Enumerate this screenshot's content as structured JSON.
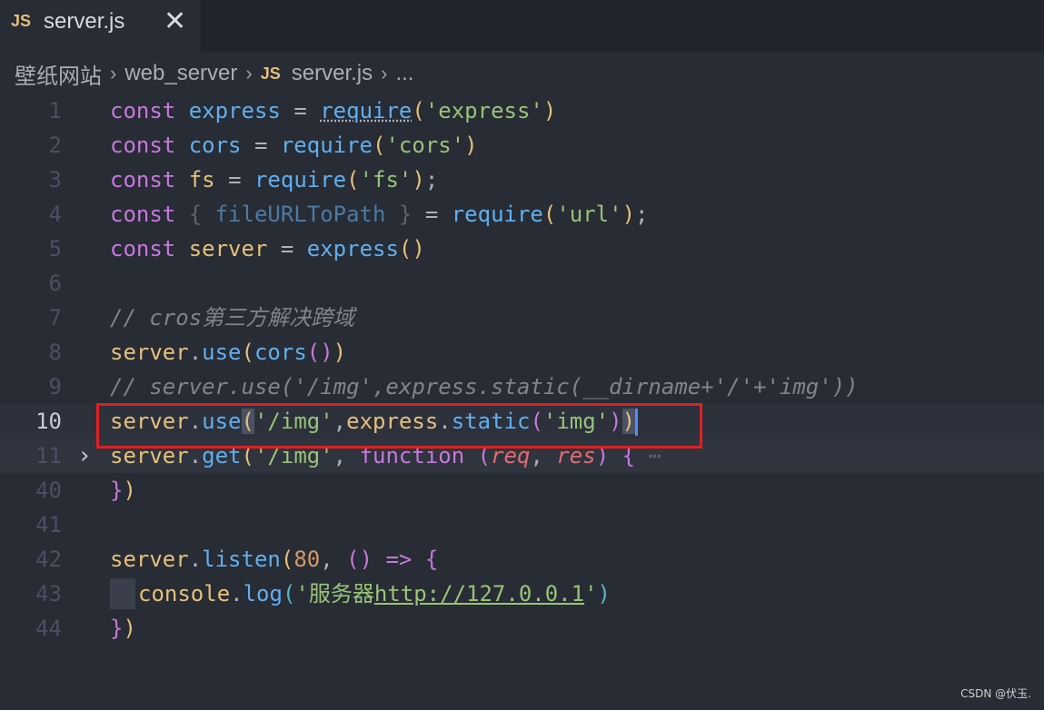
{
  "tab": {
    "icon": "JS",
    "title": "server.js",
    "close": "✕"
  },
  "breadcrumb": {
    "folder1": "壁纸网站",
    "folder2": "web_server",
    "file_icon": "JS",
    "file": "server.js",
    "more": "..."
  },
  "lines": {
    "l1": "1",
    "l2": "2",
    "l3": "3",
    "l4": "4",
    "l5": "5",
    "l6": "6",
    "l7": "7",
    "l8": "8",
    "l9": "9",
    "l10": "10",
    "l11": "11",
    "l40": "40",
    "l41": "41",
    "l42": "42",
    "l43": "43",
    "l44": "44"
  },
  "code": {
    "kw_const": "const",
    "express": "express",
    "cors": "cors",
    "fs": "fs",
    "fileURLToPath": "fileURLToPath",
    "server": "server",
    "require": "require",
    "str_express": "'express'",
    "str_cors": "'cors'",
    "str_fs": "'fs'",
    "str_url": "'url'",
    "comment7": "// cros第三方解决跨域",
    "comment9": "// server.use('/img',express.static(__dirname+'/'+'img'))",
    "use": "use",
    "static": "static",
    "str_img_path": "'/img'",
    "str_img": "'img'",
    "get": "get",
    "kw_function": "function",
    "req": "req",
    "res": "res",
    "fold_dots": "⋯",
    "listen": "listen",
    "port": "80",
    "arrow": "=>",
    "console": "console",
    "log": "log",
    "str_prefix": "'服务器",
    "url_text": "http://127.0.0.1",
    "str_suffix": "'"
  },
  "watermark": "CSDN @伏玉."
}
